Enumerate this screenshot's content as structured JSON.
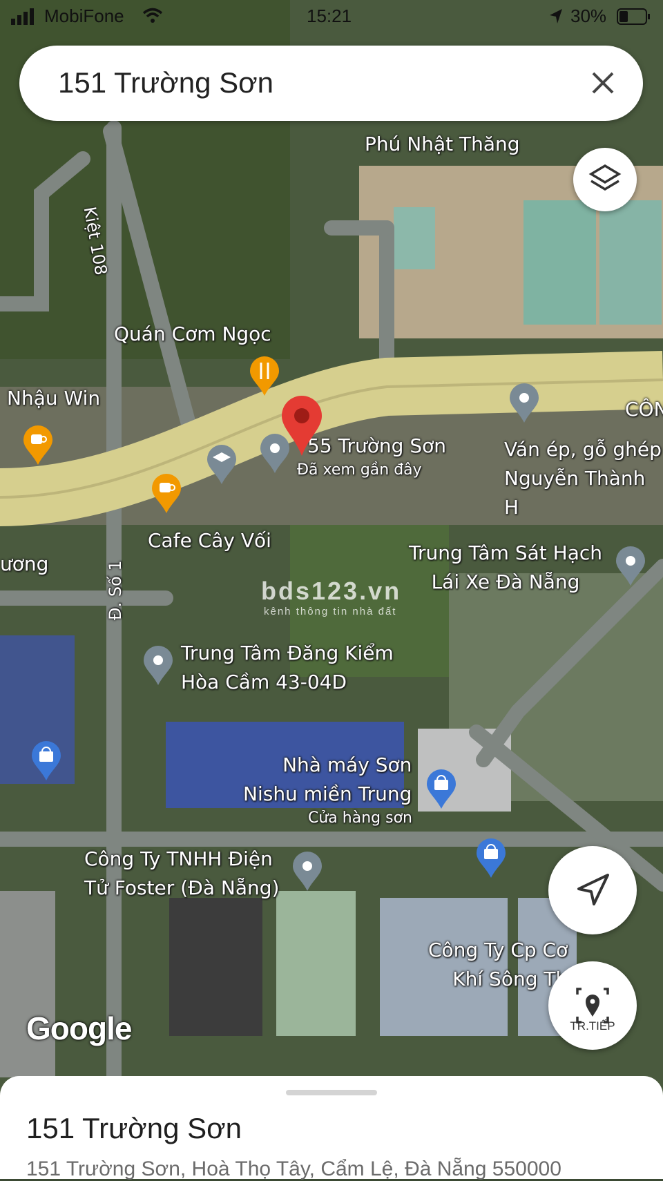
{
  "status_bar": {
    "carrier": "MobiFone",
    "time": "15:21",
    "battery": "30%"
  },
  "search": {
    "query": "151 Trường Sơn"
  },
  "map": {
    "watermark": {
      "title": "bds123.vn",
      "subtitle": "kênh thông tin nhà đất"
    },
    "labels": {
      "phu_nhat_thang": "Phú Nhật Thăng",
      "kiet108": "Kiệt 108",
      "quan_com_ngoc": "Quán Cơm Ngọc",
      "nhau_win": "Nhậu Win",
      "truong_son_55": "55 Trường Sơn",
      "da_xem": "Đã xem gần đây",
      "van_ep": "Ván ép, gỗ ghép\nNguyễn Thành H",
      "cafe_cay_voi": "Cafe Cây Vối",
      "uong": "ương",
      "sat_hach": "Trung Tâm Sát Hạch\nLái Xe Đà Nẵng",
      "d_so_1": "Đ. Số 1",
      "dang_kiem": "Trung Tâm Đăng Kiểm\nHòa Cầm 43-04D",
      "nishu": "Nhà máy Sơn\nNishu miền Trung",
      "cua_hang_son": "Cửa hàng sơn",
      "foster": "Công Ty TNHH Điện\nTử Foster (Đà Nẵng)",
      "song_thu": "Công Ty Cp Cơ\nKhí Sông Th",
      "con": "CÔN"
    }
  },
  "google_logo": "Google",
  "buttons": {
    "tracking_label": "TR.TIẾP"
  },
  "place_sheet": {
    "title": "151 Trường Sơn",
    "address": "151 Trường Sơn, Hoà Thọ Tây, Cẩm Lệ, Đà Nẵng 550000"
  }
}
